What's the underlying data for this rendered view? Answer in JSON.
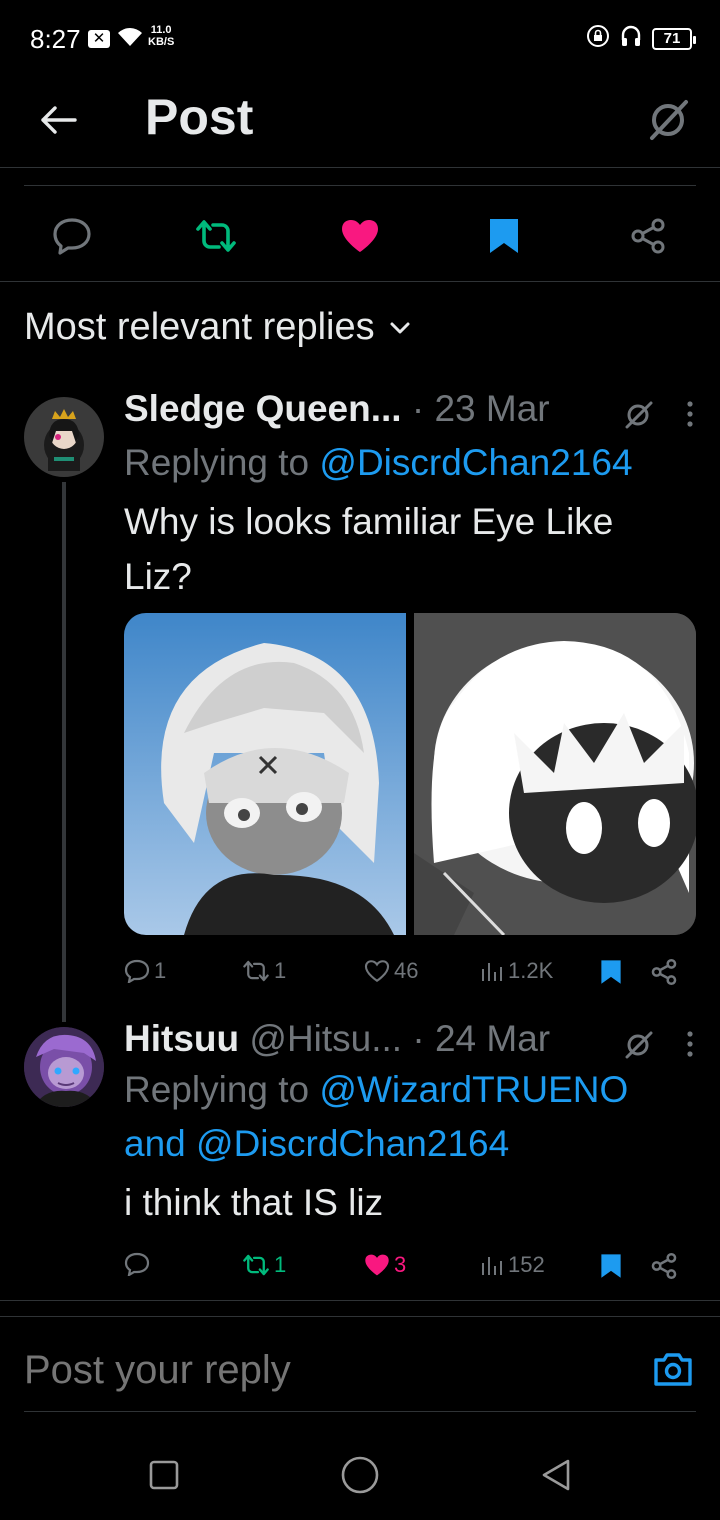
{
  "status_bar": {
    "time": "8:27",
    "notification_icon": "x-app-icon",
    "net_speed_value": "11.0",
    "net_speed_unit": "KB/S",
    "battery": "71"
  },
  "header": {
    "title": "Post",
    "back_icon": "arrow-left-icon",
    "right_icon": "grok-icon"
  },
  "action_bar": {
    "items": [
      "reply-icon",
      "repost-icon",
      "like-icon",
      "bookmark-icon",
      "share-icon"
    ],
    "colors": {
      "repost": "#00ba7c",
      "like": "#f91880",
      "bookmark": "#1d9bf0",
      "default": "#71767b"
    }
  },
  "replies_filter": {
    "label": "Most relevant replies"
  },
  "replies": [
    {
      "display_name": "Sledge Queen...",
      "date": "· 23 Mar",
      "replying_prefix": "Replying to ",
      "replying_to": "@DiscrdChan2164",
      "text": "Why is looks familiar Eye Like Liz?",
      "stats": {
        "replies": "1",
        "reposts": "1",
        "likes": "46",
        "views": "1.2K"
      }
    },
    {
      "display_name": "Hitsuu",
      "handle": "@Hitsu...",
      "date": "· 24 Mar",
      "replying_prefix": "Replying to ",
      "replying_to": "@WizardTRUENO",
      "replying_and": "and ",
      "replying_to_2": "@DiscrdChan2164",
      "text": "i think that IS liz",
      "stats": {
        "reposts": "1",
        "likes": "3",
        "views": "152"
      }
    }
  ],
  "compose": {
    "placeholder": "Post your reply"
  }
}
